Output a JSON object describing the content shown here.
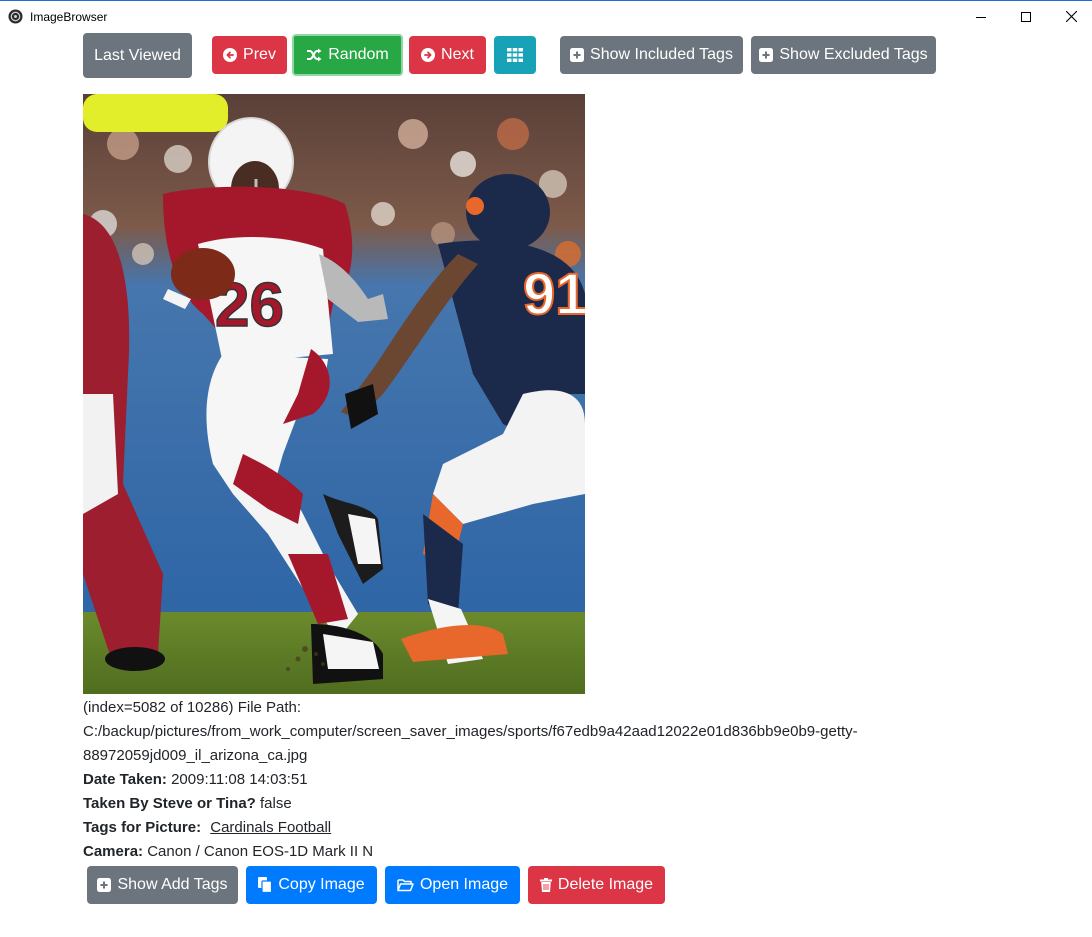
{
  "window": {
    "title": "ImageBrowser",
    "minimize_icon": "minimize-icon",
    "maximize_icon": "maximize-icon",
    "close_icon": "close-icon"
  },
  "toolbar": {
    "last_viewed": "Last Viewed",
    "prev": "Prev",
    "random": "Random",
    "next": "Next",
    "grid_icon": "grid-icon",
    "show_included_tags": "Show Included Tags",
    "show_excluded_tags": "Show Excluded Tags"
  },
  "image": {
    "index_text": "(index=5082 of 10286) File Path:",
    "path_line1": "C:/backup/pictures/from_work_computer/screen_saver_images/sports/f67edb9a42aad12022e01d836bb9e0b9-getty-",
    "path_line2": "88972059jd009_il_arizona_ca.jpg",
    "date_label": "Date Taken:",
    "date_value": "2009:11:08 14:03:51",
    "taken_by_label": "Taken By Steve or Tina?",
    "taken_by_value": "false",
    "tags_label": "Tags for Picture:",
    "tags": [
      "Cardinals Football"
    ],
    "camera_label": "Camera:",
    "camera_value": "Canon / Canon EOS-1D Mark II N"
  },
  "actions": {
    "show_add_tags": "Show Add Tags",
    "copy_image": "Copy Image",
    "open_image": "Open Image",
    "delete_image": "Delete Image"
  },
  "colors": {
    "secondary": "#6c757d",
    "danger": "#dc3545",
    "success": "#28a745",
    "info": "#17a2b8",
    "primary": "#007bff"
  }
}
